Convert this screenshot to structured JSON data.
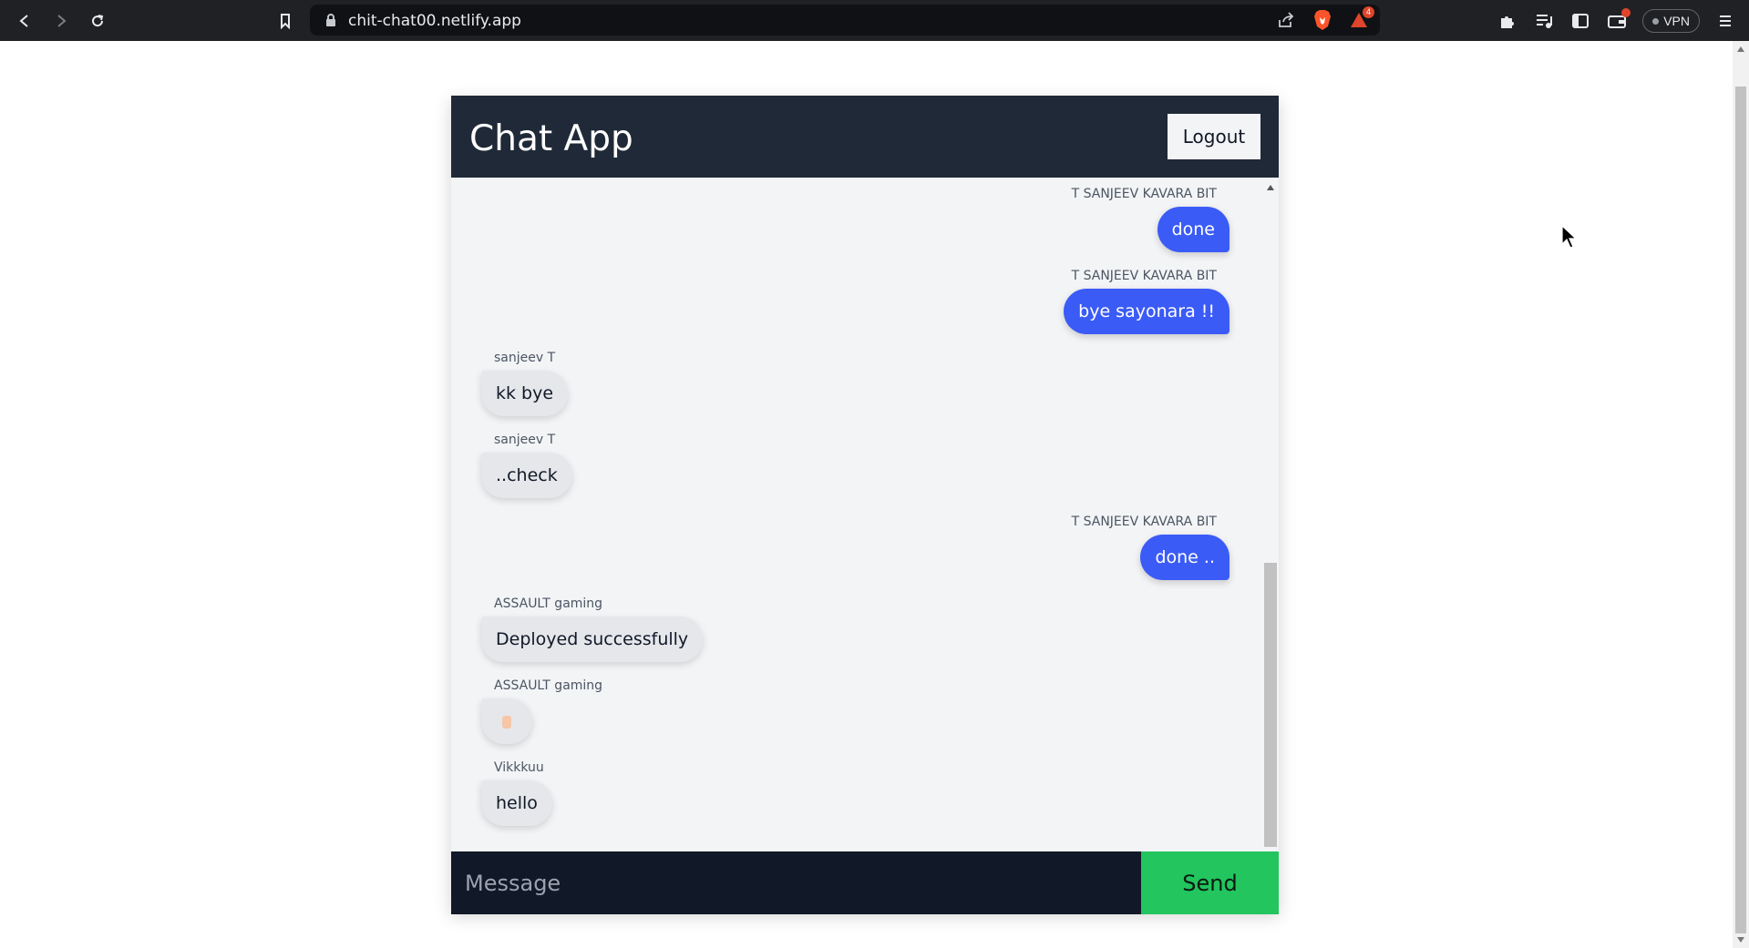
{
  "browser": {
    "url": "chit-chat00.netlify.app",
    "rewards_count": "4",
    "vpn_label": "VPN"
  },
  "app": {
    "title": "Chat App",
    "logout_label": "Logout"
  },
  "messages": [
    {
      "sender": "T SANJEEV KAVARA BIT",
      "text": "done",
      "direction": "outgoing"
    },
    {
      "sender": "T SANJEEV KAVARA BIT",
      "text": "bye sayonara !!",
      "direction": "outgoing"
    },
    {
      "sender": "sanjeev T",
      "text": "kk bye",
      "direction": "incoming"
    },
    {
      "sender": "sanjeev T",
      "text": "..check",
      "direction": "incoming"
    },
    {
      "sender": "T SANJEEV KAVARA BIT",
      "text": "done ..",
      "direction": "outgoing"
    },
    {
      "sender": "ASSAULT gaming",
      "text": "Deployed successfully",
      "direction": "incoming"
    },
    {
      "sender": "ASSAULT gaming",
      "text": "",
      "direction": "incoming",
      "emoji_icon": "hand-emoji"
    },
    {
      "sender": "Vikkkuu",
      "text": "hello",
      "direction": "incoming"
    }
  ],
  "composer": {
    "placeholder": "Message",
    "send_label": "Send"
  },
  "colors": {
    "header_bg": "#1f2937",
    "outgoing_bubble": "#3b5bf6",
    "incoming_bubble": "#e5e7eb",
    "send_button": "#22c55e",
    "input_bg": "#111827"
  }
}
